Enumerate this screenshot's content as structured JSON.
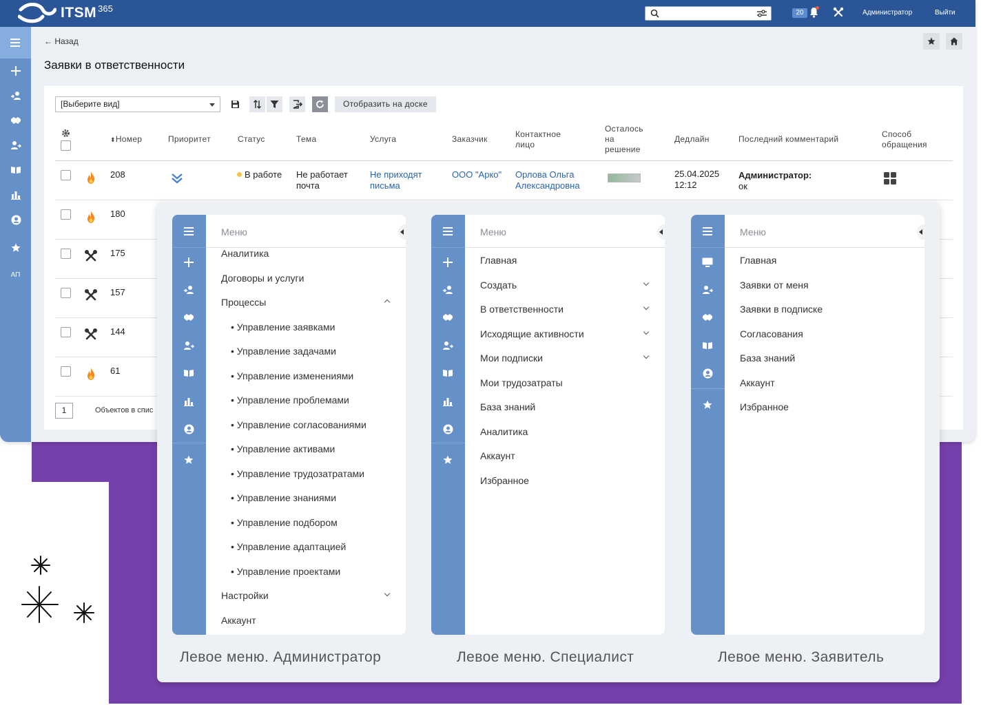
{
  "app": {
    "logo_text": "ITSM",
    "logo_sup": "365",
    "search": {
      "value": "",
      "placeholder": ""
    },
    "notifications_count": "20",
    "user_label": "Администратор",
    "logout_label": "Выйти",
    "sidebar_short_label": "АП",
    "back_label": "← Назад",
    "page_title": "Заявки в ответственности"
  },
  "toolbar": {
    "view_select": "[Выберите вид]",
    "show_on_board": "Отобразить на доске"
  },
  "table": {
    "headers": {
      "number": "Номер",
      "priority": "Приоритет",
      "status": "Статус",
      "subject": "Тема",
      "service": "Услуга",
      "customer": "Заказчик",
      "contact_1": "Контактное",
      "contact_2": "лицо",
      "remaining_1": "Осталось",
      "remaining_2": "на",
      "remaining_3": "решение",
      "deadline": "Дедлайн",
      "last_comment": "Последний комментарий",
      "channel_1": "Способ",
      "channel_2": "обращения"
    },
    "rows": [
      {
        "number": "208",
        "type_icon": "fire-icon",
        "priority_icon": "chevrons-down-icon",
        "status": "В работе",
        "subject_1": "Не работает",
        "subject_2": "почта",
        "service_1": "Не приходят",
        "service_2": "письма",
        "customer": "ООО \"Арко\"",
        "contact_1": "Орлова Ольга",
        "contact_2": "Александровна",
        "deadline_1": "25.04.2025",
        "deadline_2": "12:12",
        "comment_author": "Администратор:",
        "comment_text": "ок",
        "channel_icon": "grid-icon"
      },
      {
        "number": "180",
        "type_icon": "fire-icon"
      },
      {
        "number": "175",
        "type_icon": "tools-icon"
      },
      {
        "number": "157",
        "type_icon": "tools-icon"
      },
      {
        "number": "144",
        "type_icon": "tools-icon"
      },
      {
        "number": "61",
        "type_icon": "fire-icon"
      }
    ],
    "pager": {
      "page": "1",
      "objects_label": "Объектов в спис"
    }
  },
  "menus": {
    "admin": {
      "title": "Меню",
      "items": [
        "Аналитика",
        "Договоры и услуги",
        "Процессы",
        "• Управление заявками",
        "• Управление задачами",
        "• Управление изменениями",
        "• Управление проблемами",
        "• Управление согласованиями",
        "• Управление активами",
        "• Управление трудозатратами",
        "• Управление знаниями",
        "• Управление подбором",
        "• Управление адаптацией",
        "• Управление проектами",
        "Настройки",
        "Аккаунт"
      ],
      "caption": "Левое меню. Администратор"
    },
    "specialist": {
      "title": "Меню",
      "items": [
        "Главная",
        "Создать",
        "В ответственности",
        "Исходящие активности",
        "Мои подписки",
        "Мои трудозатраты",
        "База знаний",
        "Аналитика",
        "Аккаунт",
        "Избранное"
      ],
      "caption": "Левое меню. Специалист"
    },
    "requester": {
      "title": "Меню",
      "items": [
        "Главная",
        "Заявки от меня",
        "Заявки в подписке",
        "Согласования",
        "База знаний",
        "Аккаунт",
        "Избранное"
      ],
      "caption": "Левое меню. Заявитель"
    }
  },
  "colors": {
    "topbar": "#2a5596",
    "sidebar": "#6590c8",
    "accent_purple": "#7640ab",
    "link": "#2a63b0"
  }
}
